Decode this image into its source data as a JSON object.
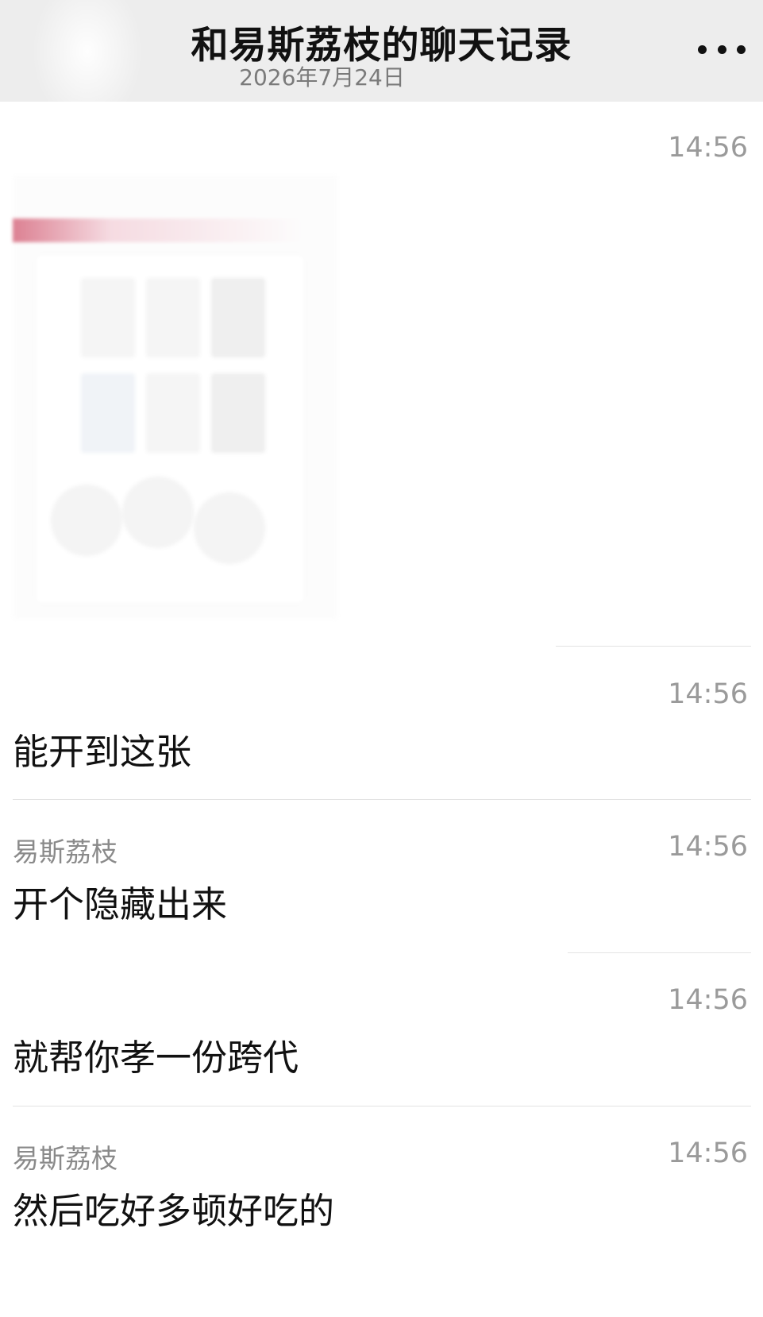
{
  "header": {
    "title": "和易斯荔枝的聊天记录",
    "date": "2026年7月24日",
    "more_icon": "more-dots-icon"
  },
  "messages": [
    {
      "sender": "",
      "time": "14:56",
      "type": "image",
      "text": ""
    },
    {
      "sender": "",
      "time": "14:56",
      "type": "text",
      "text": "能开到这张"
    },
    {
      "sender": "易斯荔枝",
      "time": "14:56",
      "type": "text",
      "text": "开个隐藏出来"
    },
    {
      "sender": "",
      "time": "14:56",
      "type": "text",
      "text": "就帮你孝一份跨代"
    },
    {
      "sender": "易斯荔枝",
      "time": "14:56",
      "type": "text",
      "text": "然后吃好多顿好吃的"
    }
  ],
  "colors": {
    "header_bg": "#ededed",
    "text_primary": "#111111",
    "text_secondary": "#8a8a8a",
    "divider": "#e3e3e3"
  }
}
